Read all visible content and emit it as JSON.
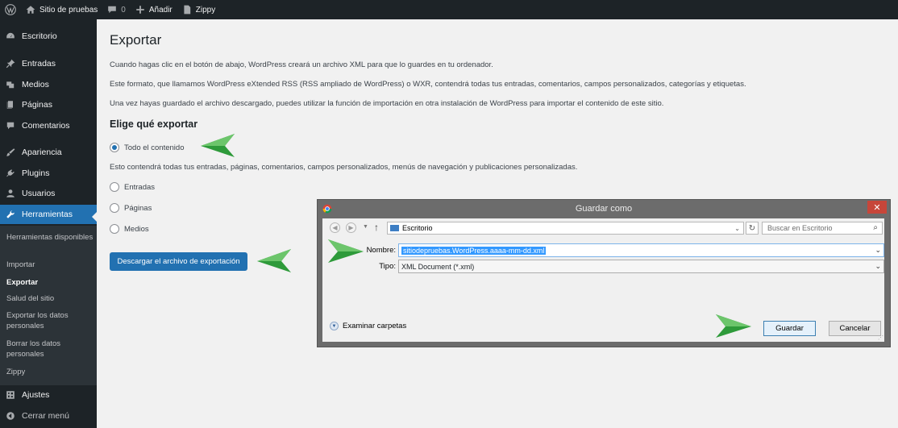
{
  "adminbar": {
    "site_name": "Sitio de pruebas",
    "comments_count": "0",
    "new_label": "Añadir",
    "plugin_label": "Zippy"
  },
  "sidebar": {
    "items": [
      {
        "label": "Escritorio",
        "icon": "dashboard-icon"
      },
      {
        "label": "Entradas",
        "icon": "pin-icon"
      },
      {
        "label": "Medios",
        "icon": "media-icon"
      },
      {
        "label": "Páginas",
        "icon": "pages-icon"
      },
      {
        "label": "Comentarios",
        "icon": "comment-icon"
      },
      {
        "label": "Apariencia",
        "icon": "brush-icon"
      },
      {
        "label": "Plugins",
        "icon": "plugin-icon"
      },
      {
        "label": "Usuarios",
        "icon": "users-icon"
      },
      {
        "label": "Herramientas",
        "icon": "wrench-icon",
        "active": true
      }
    ],
    "submenu": [
      {
        "label": "Herramientas disponibles"
      },
      {
        "label": "Importar"
      },
      {
        "label": "Exportar",
        "current": true
      },
      {
        "label": "Salud del sitio"
      },
      {
        "label": "Exportar los datos personales"
      },
      {
        "label": "Borrar los datos personales"
      },
      {
        "label": "Zippy"
      }
    ],
    "settings": {
      "label": "Ajustes",
      "icon": "settings-icon"
    },
    "collapse": {
      "label": "Cerrar menú",
      "icon": "collapse-icon"
    }
  },
  "main": {
    "title": "Exportar",
    "p1": "Cuando hagas clic en el botón de abajo, WordPress creará un archivo XML para que lo guardes en tu ordenador.",
    "p2": "Este formato, que llamamos WordPress eXtended RSS (RSS ampliado de WordPress) o WXR, contendrá todas tus entradas, comentarios, campos personalizados, categorías y etiquetas.",
    "p3": "Una vez hayas guardado el archivo descargado, puedes utilizar la función de importación en otra instalación de WordPress para importar el contenido de este sitio.",
    "section_title": "Elige qué exportar",
    "options": {
      "all": "Todo el contenido",
      "all_desc": "Esto contendrá todas tus entradas, páginas, comentarios, campos personalizados, menús de navegación y publicaciones personalizadas.",
      "posts": "Entradas",
      "pages": "Páginas",
      "media": "Medios"
    },
    "selected_option": "all",
    "download_button": "Descargar el archivo de exportación"
  },
  "dialog": {
    "title": "Guardar como",
    "close": "✕",
    "location": "Escritorio",
    "search_placeholder": "Buscar en Escritorio",
    "filename_label": "Nombre:",
    "filename_value": "sitiodepruebas.WordPress.aaaa-mm-dd.xml",
    "type_label": "Tipo:",
    "type_value": "XML Document (*.xml)",
    "browse_label": "Examinar carpetas",
    "save_button": "Guardar",
    "cancel_button": "Cancelar"
  },
  "colors": {
    "admin_dark": "#1d2327",
    "accent_blue": "#2271b1",
    "arrow_green": "#2e9a3a"
  }
}
